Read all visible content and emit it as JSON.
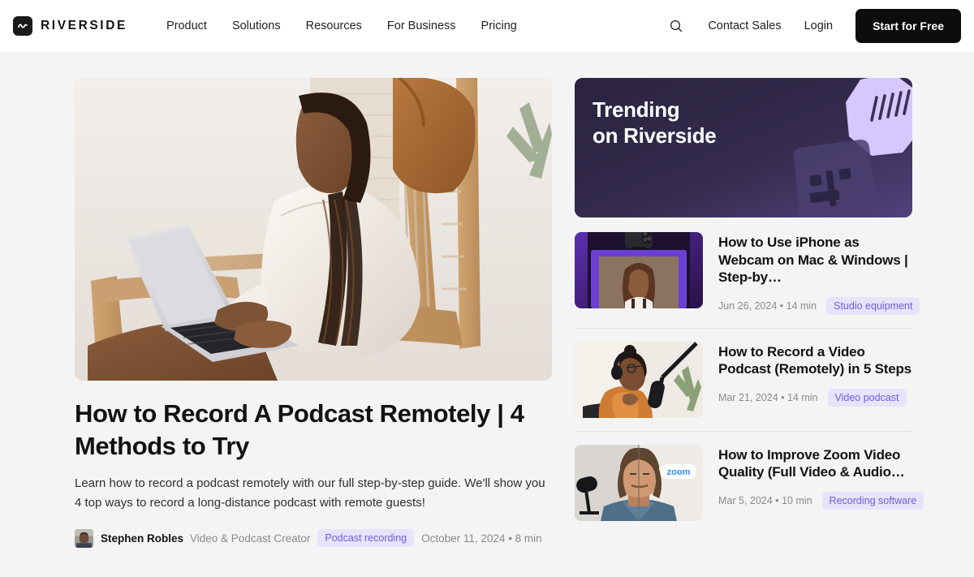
{
  "nav": {
    "brand": {
      "name": "RIVERSIDE",
      "logo_icon": "waveform-icon"
    },
    "links": [
      {
        "label": "Product"
      },
      {
        "label": "Solutions"
      },
      {
        "label": "Resources"
      },
      {
        "label": "For Business"
      },
      {
        "label": "Pricing"
      }
    ],
    "search_icon": "search-icon",
    "contact_sales": "Contact Sales",
    "login": "Login",
    "cta": "Start for Free"
  },
  "featured": {
    "image_alt": "Woman in white sweater typing on a laptop while seated in a wooden lounge chair",
    "title": "How to Record A Podcast Remotely | 4 Methods to Try",
    "description": "Learn how to record a podcast remotely with our full step-by-step guide. We'll show you 4 top ways to record a long-distance podcast with remote guests!",
    "author": "Stephen Robles",
    "author_role": "Video & Podcast Creator",
    "tag": "Podcast recording",
    "meta": "October 11, 2024 • 8 min"
  },
  "trending": {
    "banner_title": "Trending\non Riverside",
    "items": [
      {
        "title": "How to Use iPhone as Webcam on Mac & Windows | Step-by…",
        "meta": "Jun 26, 2024 • 14 min",
        "tag": "Studio equipment",
        "image_alt": "iPhone mounted above a monitor showing a smiling woman on a purple background"
      },
      {
        "title": "How to Record a Video Podcast (Remotely) in 5 Steps",
        "meta": "Mar 21, 2024 • 14 min",
        "tag": "Video podcast",
        "image_alt": "Woman in orange shirt wearing headphones speaking into a boom microphone"
      },
      {
        "title": "How to Improve Zoom Video Quality (Full Video & Audio…",
        "meta": "Mar 5, 2024 • 10 min",
        "tag": "Recording software",
        "image_alt": "Split before-and-after portrait of a man beside a microphone with a zoom badge"
      }
    ]
  },
  "colors": {
    "page_bg": "#f4f4f4",
    "nav_bg": "#ffffff",
    "text": "#121212",
    "muted": "#8a8a8a",
    "tag_bg": "#e6e3fb",
    "tag_text": "#6d5ee0",
    "cta_bg": "#0d0d0d",
    "banner_dark": "#2b2340",
    "banner_light": "#4b3d72",
    "accent_lavender": "#d6c8fb"
  }
}
